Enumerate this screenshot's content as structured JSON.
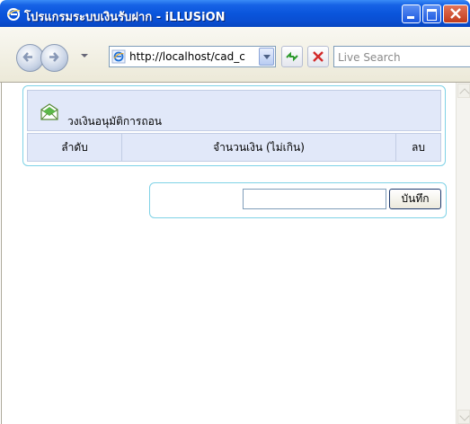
{
  "window": {
    "title": "โปรแกรมระบบเงินรับฝาก - iLLUSiON"
  },
  "navbar": {
    "address": "http://localhost/cad_c",
    "search_placeholder": "Live Search"
  },
  "panel": {
    "title": "วงเงินอนุมัติการถอน",
    "columns": [
      "ลำดับ",
      "จำนวนเงิน (ไม่เกิน)",
      "ลบ"
    ]
  },
  "form": {
    "amount_value": "",
    "save_label": "บันทึก"
  },
  "colors": {
    "titlebar": "#0a55dc",
    "panel_border": "#7fd2e6",
    "header_bg": "#e1e8f9"
  }
}
